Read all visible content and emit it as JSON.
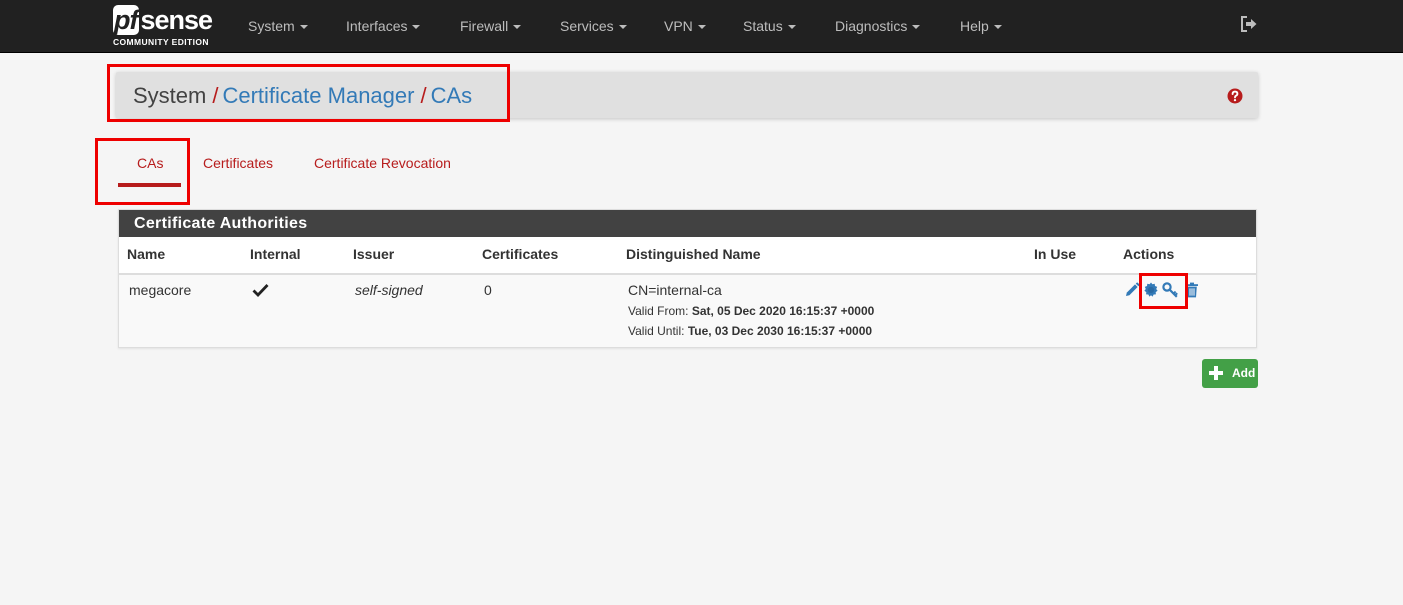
{
  "brand": {
    "logo_prefix": "pf",
    "logo_suffix": "sense",
    "edition": "COMMUNITY EDITION"
  },
  "nav": {
    "items": [
      {
        "label": "System"
      },
      {
        "label": "Interfaces"
      },
      {
        "label": "Firewall"
      },
      {
        "label": "Services"
      },
      {
        "label": "VPN"
      },
      {
        "label": "Status"
      },
      {
        "label": "Diagnostics"
      },
      {
        "label": "Help"
      }
    ],
    "logout_icon": "sign-out-icon"
  },
  "breadcrumb": {
    "root": "System",
    "sep": "/",
    "level1": "Certificate Manager",
    "level2": "CAs",
    "help_icon": "question-circle-icon"
  },
  "tabs": [
    {
      "label": "CAs",
      "active": true
    },
    {
      "label": "Certificates",
      "active": false
    },
    {
      "label": "Certificate Revocation",
      "active": false
    }
  ],
  "panel": {
    "title": "Certificate Authorities",
    "columns": [
      "Name",
      "Internal",
      "Issuer",
      "Certificates",
      "Distinguished Name",
      "In Use",
      "Actions"
    ],
    "rows": [
      {
        "name": "megacore",
        "internal_icon": "check-icon",
        "issuer": "self-signed",
        "certificates": "0",
        "dn": "CN=internal-ca",
        "valid_from_label": "Valid From:",
        "valid_from": "Sat, 05 Dec 2020 16:15:37 +0000",
        "valid_until_label": "Valid Until:",
        "valid_until": "Tue, 03 Dec 2030 16:15:37 +0000",
        "in_use": "",
        "actions": [
          "pencil-icon",
          "certificate-icon",
          "key-icon",
          "trash-icon"
        ]
      }
    ]
  },
  "add_button": {
    "label": "Add",
    "icon": "plus-icon"
  },
  "colors": {
    "navbar": "#212121",
    "accent_red": "#b71c1c",
    "link_blue": "#337ab7",
    "panel_heading": "#424242",
    "add_green": "#43a047",
    "highlight": "#ee0000"
  }
}
